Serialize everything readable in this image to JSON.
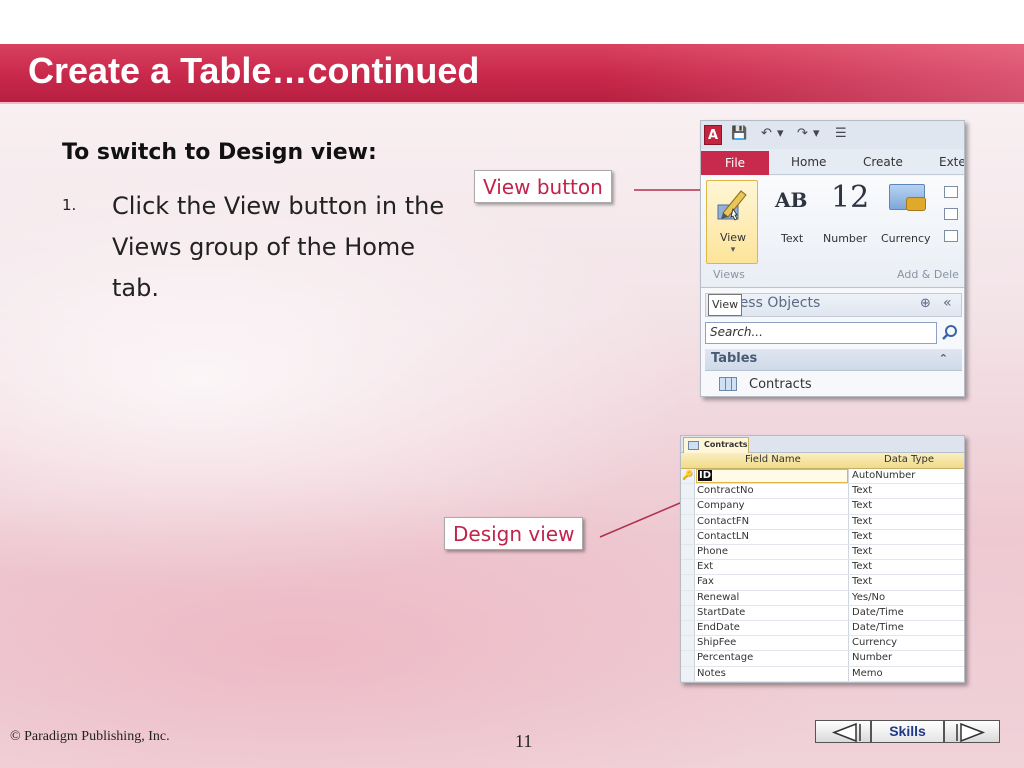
{
  "slide": {
    "title": "Create a Table…continued",
    "heading": "To switch to Design view:",
    "step_number": "1.",
    "step_text": "Click the View button in the Views group of the Home tab.",
    "page_number": "11",
    "copyright": "© Paradigm Publishing, Inc.",
    "accent_color": "#c8284b"
  },
  "callouts": {
    "view_button": "View button",
    "design_view": "Design view"
  },
  "ribbon": {
    "tabs": [
      "File",
      "Home",
      "Create",
      "Exte"
    ],
    "view_label": "View",
    "group_views": "Views",
    "group_add": "Add & Dele",
    "buttons": [
      {
        "icon": "AB",
        "label": "Text"
      },
      {
        "icon": "12",
        "label": "Number"
      },
      {
        "icon": "currency-icon",
        "label": "Currency"
      }
    ],
    "tooltip": "View",
    "nav_title": "cess Objects",
    "search_placeholder": "Search...",
    "tables_header": "Tables",
    "table_item": "Contracts"
  },
  "design": {
    "tab_label": "Contracts",
    "col_field": "Field Name",
    "col_type": "Data Type",
    "rows": [
      {
        "field": "ID",
        "type": "AutoNumber"
      },
      {
        "field": "ContractNo",
        "type": "Text"
      },
      {
        "field": "Company",
        "type": "Text"
      },
      {
        "field": "ContactFN",
        "type": "Text"
      },
      {
        "field": "ContactLN",
        "type": "Text"
      },
      {
        "field": "Phone",
        "type": "Text"
      },
      {
        "field": "Ext",
        "type": "Text"
      },
      {
        "field": "Fax",
        "type": "Text"
      },
      {
        "field": "Renewal",
        "type": "Yes/No"
      },
      {
        "field": "StartDate",
        "type": "Date/Time"
      },
      {
        "field": "EndDate",
        "type": "Date/Time"
      },
      {
        "field": "ShipFee",
        "type": "Currency"
      },
      {
        "field": "Percentage",
        "type": "Number"
      },
      {
        "field": "Notes",
        "type": "Memo"
      }
    ]
  },
  "footer": {
    "skills_label": "Skills",
    "prev_icon": "triangle-left-icon",
    "next_icon": "triangle-right-icon"
  }
}
